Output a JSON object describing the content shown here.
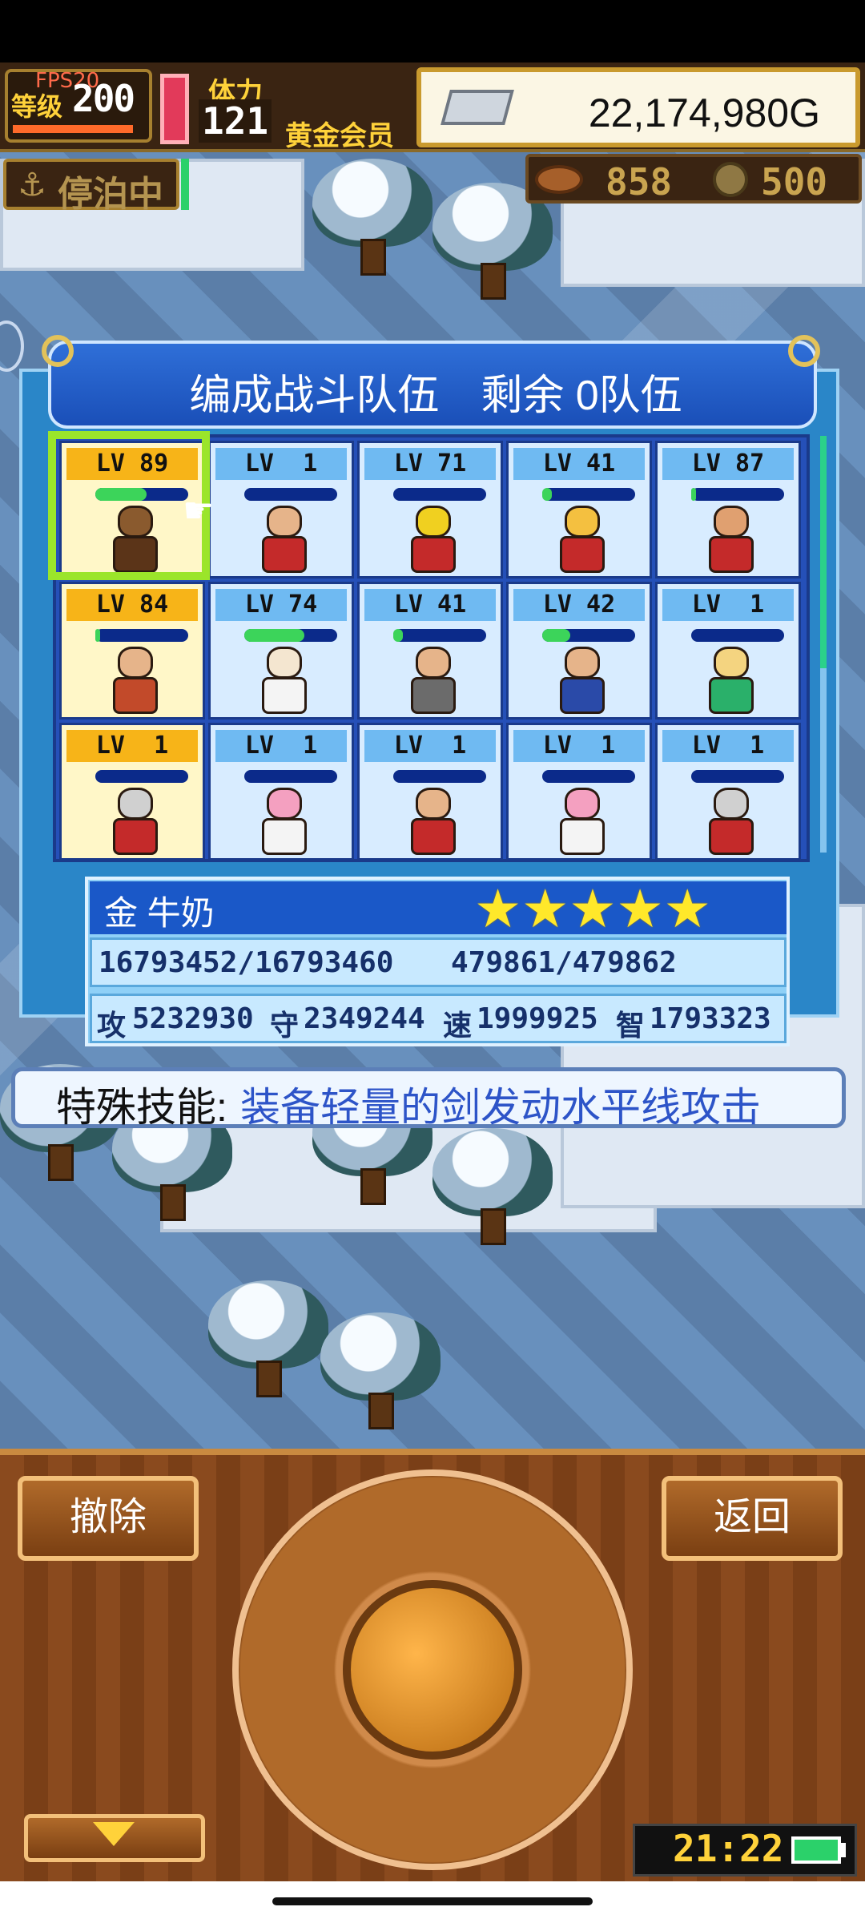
{
  "hud": {
    "fps": "FPS20",
    "level_label": "等级",
    "level_value": "200",
    "stamina_label": "体力",
    "stamina_value": "121",
    "membership": "黄金会员",
    "gold": "22,174,980G",
    "dock_status": "停泊中",
    "resource1": "858",
    "resource2": "500"
  },
  "dialog": {
    "title": "编成战斗队伍　剩余 0队伍",
    "members": [
      {
        "lv": "LV 89",
        "hp_pct": 55,
        "color": "gold",
        "skin": "#8a5a2e",
        "outfit": "#5b3418"
      },
      {
        "lv": "LV  1",
        "hp_pct": 0,
        "color": "blue",
        "skin": "#e6b48a",
        "outfit": "#c42a2a"
      },
      {
        "lv": "LV 71",
        "hp_pct": 0,
        "color": "blue",
        "skin": "#f0d020",
        "outfit": "#c42a2a"
      },
      {
        "lv": "LV 41",
        "hp_pct": 10,
        "color": "blue",
        "skin": "#f4c040",
        "outfit": "#c42a2a"
      },
      {
        "lv": "LV 87",
        "hp_pct": 5,
        "color": "blue",
        "skin": "#e0a070",
        "outfit": "#c42a2a"
      },
      {
        "lv": "LV 84",
        "hp_pct": 5,
        "color": "gold",
        "skin": "#e6b48a",
        "outfit": "#c24a2a"
      },
      {
        "lv": "LV 74",
        "hp_pct": 65,
        "color": "blue",
        "skin": "#f4e6d0",
        "outfit": "#f4f4f4"
      },
      {
        "lv": "LV 41",
        "hp_pct": 10,
        "color": "blue",
        "skin": "#e6b48a",
        "outfit": "#6b6b6b"
      },
      {
        "lv": "LV 42",
        "hp_pct": 30,
        "color": "blue",
        "skin": "#e6b48a",
        "outfit": "#2a4aa8"
      },
      {
        "lv": "LV  1",
        "hp_pct": 0,
        "color": "blue",
        "skin": "#f4d480",
        "outfit": "#2ab06a"
      },
      {
        "lv": "LV  1",
        "hp_pct": 0,
        "color": "gold",
        "skin": "#d0d0d0",
        "outfit": "#c42a2a"
      },
      {
        "lv": "LV  1",
        "hp_pct": 0,
        "color": "blue",
        "skin": "#f4a0c0",
        "outfit": "#f4f4f4"
      },
      {
        "lv": "LV  1",
        "hp_pct": 0,
        "color": "blue",
        "skin": "#e6b48a",
        "outfit": "#c42a2a"
      },
      {
        "lv": "LV  1",
        "hp_pct": 0,
        "color": "blue",
        "skin": "#f4a0c0",
        "outfit": "#f4f4f4"
      },
      {
        "lv": "LV  1",
        "hp_pct": 0,
        "color": "blue",
        "skin": "#d0d0d0",
        "outfit": "#c42a2a"
      }
    ]
  },
  "info": {
    "name": "金 牛奶",
    "stars": "★★★★★",
    "hp": "16793452/16793460",
    "mp": "479861/479862",
    "atk_label": "攻",
    "atk": "5232930",
    "def_label": "守",
    "def": "2349244",
    "spd_label": "速",
    "spd": "1999925",
    "int_label": "智",
    "int": "1793323"
  },
  "skill": {
    "prefix": "特殊技能:",
    "text": "装备轻量的剑发动水平线攻击"
  },
  "controls": {
    "remove_label": "撤除",
    "back_label": "返回",
    "clock": "21:22"
  }
}
